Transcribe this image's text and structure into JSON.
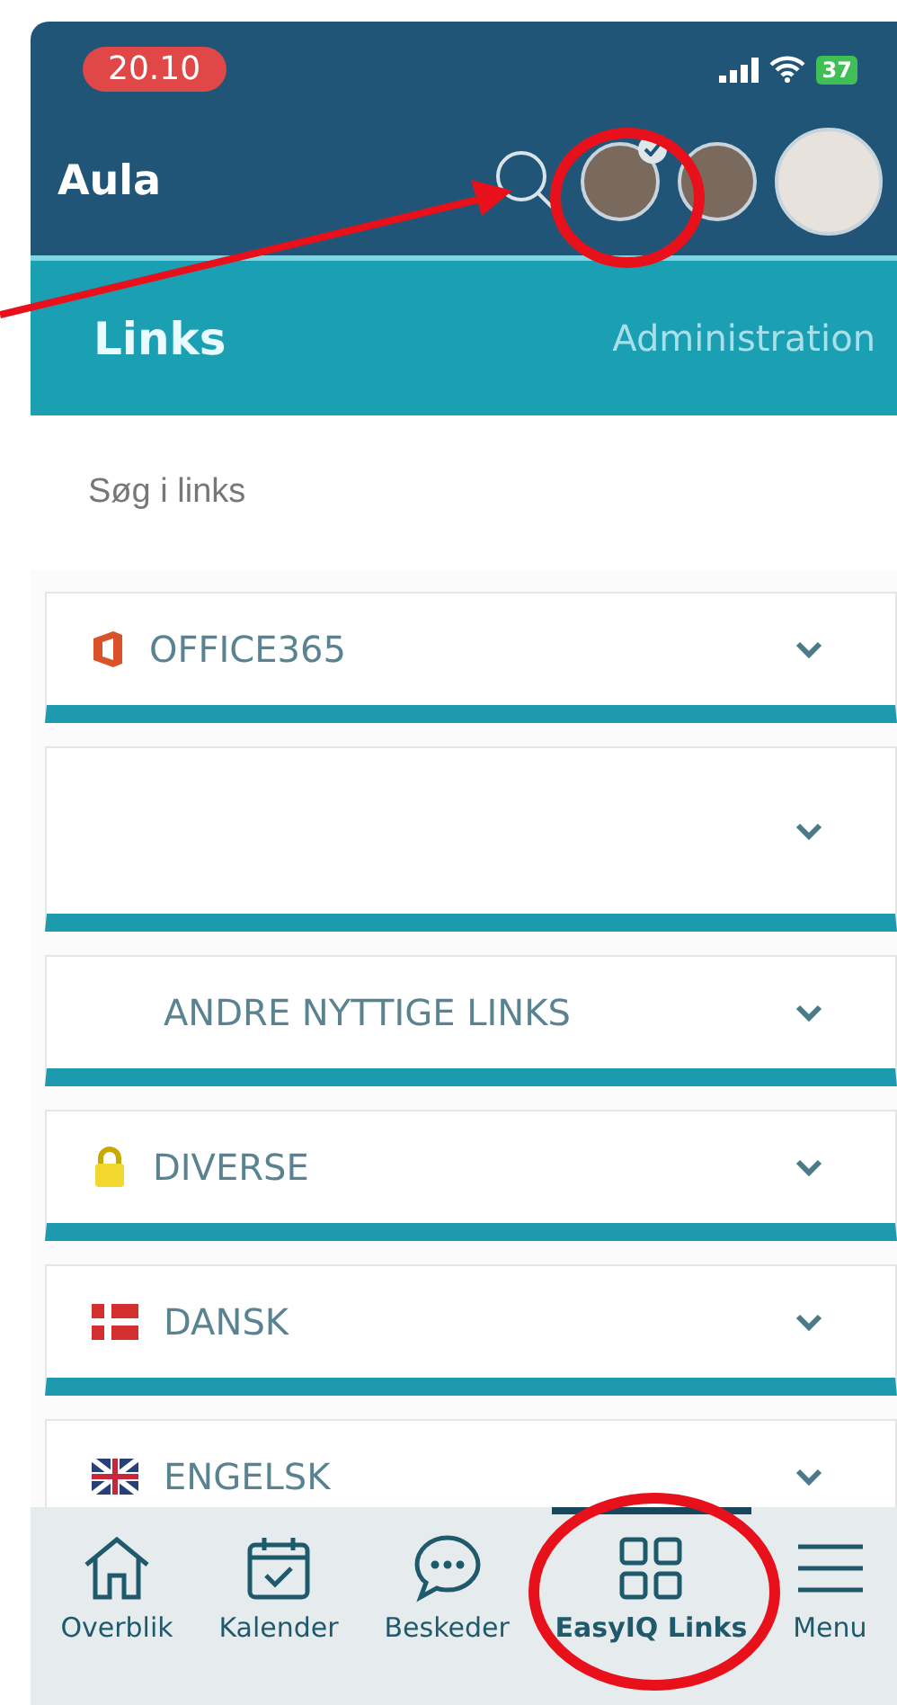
{
  "status_bar": {
    "time": "20.10",
    "battery": "37"
  },
  "header": {
    "title": "Aula",
    "avatars": [
      {
        "checked": true
      },
      {
        "checked": false
      },
      {
        "checked": false
      }
    ]
  },
  "section": {
    "title": "Links",
    "action": "Administration"
  },
  "search": {
    "placeholder": "Søg i links"
  },
  "groups": [
    {
      "label": "OFFICE365",
      "kind": "office"
    },
    {
      "kind": "blank"
    },
    {
      "label": "ANDRE NYTTIGE LINKS",
      "kind": "plain"
    },
    {
      "label": "DIVERSE",
      "kind": "lock"
    },
    {
      "label": "DANSK",
      "kind": "danish"
    },
    {
      "label": "ENGELSK",
      "kind": "english"
    }
  ],
  "nav": [
    {
      "label": "Overblik",
      "kind": "home",
      "selected": false
    },
    {
      "label": "Kalender",
      "kind": "calendar",
      "selected": false
    },
    {
      "label": "Beskeder",
      "kind": "chat",
      "selected": false
    },
    {
      "label": "EasyIQ Links",
      "kind": "grid",
      "selected": true
    },
    {
      "label": "Menu",
      "kind": "menu",
      "selected": false
    }
  ]
}
